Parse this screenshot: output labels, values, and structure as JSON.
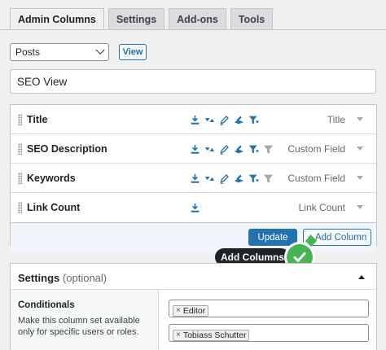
{
  "tabs": [
    "Admin Columns",
    "Settings",
    "Add-ons",
    "Tools"
  ],
  "list_screen_select": {
    "value": "Posts"
  },
  "view_button": "View",
  "title_field": {
    "value": "SEO View"
  },
  "columns": [
    {
      "label": "Title",
      "type": "Title",
      "icons": [
        "export-icon",
        "sort-icon",
        "edit-icon",
        "bulk-edit-icon",
        "smart-filter-icon"
      ]
    },
    {
      "label": "SEO Description",
      "type": "Custom Field",
      "icons": [
        "export-icon",
        "sort-icon",
        "edit-icon",
        "bulk-edit-icon",
        "smart-filter-icon",
        "filter-icon"
      ]
    },
    {
      "label": "Keywords",
      "type": "Custom Field",
      "icons": [
        "export-icon",
        "sort-icon",
        "edit-icon",
        "bulk-edit-icon",
        "smart-filter-icon",
        "filter-icon"
      ]
    },
    {
      "label": "Link Count",
      "type": "Link Count",
      "icons": [
        "export-icon"
      ]
    }
  ],
  "footer": {
    "update": "Update",
    "add_column": "+ Add Column"
  },
  "tooltip": "Add Columns",
  "settings": {
    "title": "Settings",
    "optional": "(optional)",
    "conditionals": {
      "title": "Conditionals",
      "description": "Make this column set available only for specific users or roles."
    },
    "roles_tokens": [
      "Editor"
    ],
    "users_tokens": [
      "Tobiass Schutter"
    ],
    "token_remove": "×"
  },
  "colors": {
    "primary": "#2271b1",
    "icon_active": "#2271b1",
    "icon_inactive": "#a7aaad",
    "success": "#46b450"
  }
}
